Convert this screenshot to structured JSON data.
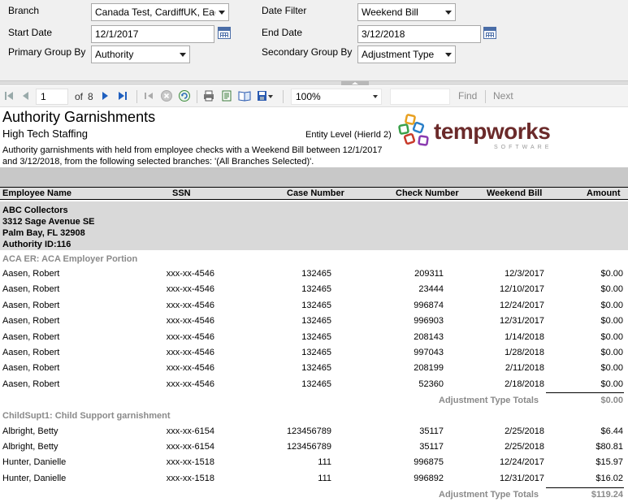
{
  "params": {
    "branch_label": "Branch",
    "branch_value": "Canada Test, CardiffUK, Eag",
    "start_date_label": "Start Date",
    "start_date_value": "12/1/2017",
    "primary_group_label": "Primary Group By",
    "primary_group_value": "Authority",
    "date_filter_label": "Date Filter",
    "date_filter_value": "Weekend Bill",
    "end_date_label": "End Date",
    "end_date_value": "3/12/2018",
    "secondary_group_label": "Secondary Group By",
    "secondary_group_value": "Adjustment Type"
  },
  "toolbar": {
    "page_current": "1",
    "page_of": "of",
    "page_total": "8",
    "zoom": "100%",
    "find_label": "Find",
    "next_label": "Next",
    "icons": [
      "first-page-icon",
      "prev-page-icon",
      "next-page-icon",
      "last-page-icon",
      "back-icon",
      "stop-icon",
      "refresh-icon",
      "print-icon",
      "print-layout-icon",
      "page-setup-icon",
      "export-icon"
    ]
  },
  "report": {
    "title": "Authority Garnishments",
    "company": "High Tech Staffing",
    "entity_level": "Entity Level (HierId 2)",
    "description": "Authority garnishments with held from employee checks with a Weekend Bill between 12/1/2017 and 3/12/2018, from the following selected branches: '(All Branches Selected)'.",
    "logo_text": "tempworks",
    "logo_sub": "SOFTWARE",
    "columns": {
      "name": "Employee Name",
      "ssn": "SSN",
      "case": "Case Number",
      "check": "Check Number",
      "week": "Weekend Bill",
      "amount": "Amount"
    },
    "authority": {
      "name": "ABC Collectors",
      "address1": "3312 Sage Avenue SE",
      "address2": "Palm Bay, FL 32908",
      "authority_id": "Authority ID:116"
    },
    "group1": {
      "label": "ACA ER: ACA Employer Portion",
      "rows": [
        {
          "name": "Aasen, Robert",
          "ssn": "xxx-xx-4546",
          "case": "132465",
          "check": "209311",
          "week": "12/3/2017",
          "amount": "$0.00"
        },
        {
          "name": "Aasen, Robert",
          "ssn": "xxx-xx-4546",
          "case": "132465",
          "check": "23444",
          "week": "12/10/2017",
          "amount": "$0.00"
        },
        {
          "name": "Aasen, Robert",
          "ssn": "xxx-xx-4546",
          "case": "132465",
          "check": "996874",
          "week": "12/24/2017",
          "amount": "$0.00"
        },
        {
          "name": "Aasen, Robert",
          "ssn": "xxx-xx-4546",
          "case": "132465",
          "check": "996903",
          "week": "12/31/2017",
          "amount": "$0.00"
        },
        {
          "name": "Aasen, Robert",
          "ssn": "xxx-xx-4546",
          "case": "132465",
          "check": "208143",
          "week": "1/14/2018",
          "amount": "$0.00"
        },
        {
          "name": "Aasen, Robert",
          "ssn": "xxx-xx-4546",
          "case": "132465",
          "check": "997043",
          "week": "1/28/2018",
          "amount": "$0.00"
        },
        {
          "name": "Aasen, Robert",
          "ssn": "xxx-xx-4546",
          "case": "132465",
          "check": "208199",
          "week": "2/11/2018",
          "amount": "$0.00"
        },
        {
          "name": "Aasen, Robert",
          "ssn": "xxx-xx-4546",
          "case": "132465",
          "check": "52360",
          "week": "2/18/2018",
          "amount": "$0.00"
        }
      ],
      "total_label": "Adjustment Type Totals",
      "total_value": "$0.00"
    },
    "group2": {
      "label": "ChildSupt1: Child Support garnishment",
      "rows": [
        {
          "name": "Albright, Betty",
          "ssn": "xxx-xx-6154",
          "case": "123456789",
          "check": "35117",
          "week": "2/25/2018",
          "amount": "$6.44"
        },
        {
          "name": "Albright, Betty",
          "ssn": "xxx-xx-6154",
          "case": "123456789",
          "check": "35117",
          "week": "2/25/2018",
          "amount": "$80.81"
        },
        {
          "name": "Hunter, Danielle",
          "ssn": "xxx-xx-1518",
          "case": "111",
          "check": "996875",
          "week": "12/24/2017",
          "amount": "$15.97"
        },
        {
          "name": "Hunter, Danielle",
          "ssn": "xxx-xx-1518",
          "case": "111",
          "check": "996892",
          "week": "12/31/2017",
          "amount": "$16.02"
        }
      ],
      "total_label": "Adjustment Type Totals",
      "total_value": "$119.24"
    }
  }
}
